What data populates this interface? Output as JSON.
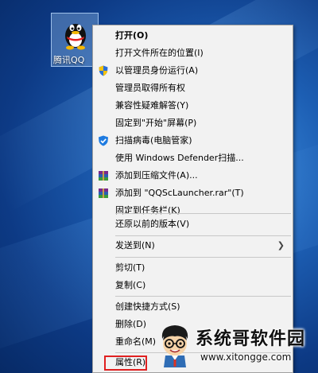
{
  "desktop": {
    "icon_label": "腾讯QQ"
  },
  "menu": {
    "open": "打开(O)",
    "open_location": "打开文件所在的位置(I)",
    "run_as_admin": "以管理员身份运行(A)",
    "take_ownership": "管理员取得所有权",
    "compat_troubleshoot": "兼容性疑难解答(Y)",
    "pin_start": "固定到\"开始\"屏幕(P)",
    "scan_virus": "扫描病毒(电脑管家)",
    "defender_scan": "使用 Windows Defender扫描...",
    "add_archive": "添加到压缩文件(A)...",
    "add_rar": "添加到 \"QQScLauncher.rar\"(T)",
    "pin_taskbar": "固定到任务栏(K)",
    "restore_versions": "还原以前的版本(V)",
    "send_to": "发送到(N)",
    "cut": "剪切(T)",
    "copy": "复制(C)",
    "create_shortcut": "创建快捷方式(S)",
    "delete": "删除(D)",
    "rename": "重命名(M)",
    "properties": "属性(R)"
  },
  "watermark": {
    "title": "系统哥软件园",
    "url": "www.xitongge.com"
  },
  "colors": {
    "highlight_box": "#e02020",
    "menu_bg": "#f2f2f2"
  }
}
